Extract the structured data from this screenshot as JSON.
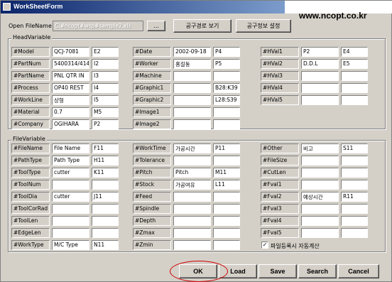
{
  "window": {
    "title": "WorkSheetForm",
    "url_banner": "www.ncopt.co.kr"
  },
  "file": {
    "label": "Open FileName",
    "value": "C:#ncopt#wsp#sample2.xls",
    "browse_label": "...",
    "view_path_label": "공구경로 보기",
    "tool_info_label": "공구정보 설정"
  },
  "head": {
    "title": "HeadVariable",
    "columns": [
      [
        {
          "name": "#Model",
          "value": "QCJ-7081",
          "code": "E2"
        },
        {
          "name": "#PartNum",
          "value": "5400314/414",
          "code": "I2"
        },
        {
          "name": "#PartName",
          "value": "PNL QTR IN",
          "code": "I3"
        },
        {
          "name": "#Process",
          "value": "OP40 REST",
          "code": "I4"
        },
        {
          "name": "#WorkLine",
          "value": "상형",
          "code": "I5"
        },
        {
          "name": "#Material",
          "value": "0.7",
          "code": "M5"
        },
        {
          "name": "#Company",
          "value": "OGIHARA",
          "code": "P2"
        }
      ],
      [
        {
          "name": "#Date",
          "value": "2002-09-18",
          "code": "P4"
        },
        {
          "name": "#Worker",
          "value": "홍길동",
          "code": "P5"
        },
        {
          "name": "#Machine",
          "value": "",
          "code": ""
        },
        {
          "name": "#Graphic1",
          "value": "",
          "code": "B28:K39"
        },
        {
          "name": "#Graphic2",
          "value": "",
          "code": "L28:S39"
        },
        {
          "name": "#Image1",
          "value": "",
          "code": ""
        },
        {
          "name": "#Image2",
          "value": "",
          "code": ""
        }
      ],
      [
        {
          "name": "#HVal1",
          "value": "P2",
          "code": "E4"
        },
        {
          "name": "#HVal2",
          "value": "D.D.L",
          "code": "E5"
        },
        {
          "name": "#HVal3",
          "value": "",
          "code": ""
        },
        {
          "name": "#HVal4",
          "value": "",
          "code": ""
        },
        {
          "name": "#HVal5",
          "value": "",
          "code": ""
        }
      ]
    ]
  },
  "filevar": {
    "title": "FileVariable",
    "columns": [
      [
        {
          "name": "#FileName",
          "value": "File Name",
          "code": "F11"
        },
        {
          "name": "#PathType",
          "value": "Path Type",
          "code": "H11"
        },
        {
          "name": "#ToolType",
          "value": "cutter",
          "code": "K11"
        },
        {
          "name": "#ToolNum",
          "value": "",
          "code": ""
        },
        {
          "name": "#ToolDia",
          "value": "cutter",
          "code": "J11"
        },
        {
          "name": "#ToolCorRad",
          "value": "",
          "code": ""
        },
        {
          "name": "#ToolLen",
          "value": "",
          "code": ""
        },
        {
          "name": "#EdgeLen",
          "value": "",
          "code": ""
        },
        {
          "name": "#WorkType",
          "value": "M/C Type",
          "code": "N11"
        }
      ],
      [
        {
          "name": "#WorkTime",
          "value": "가공시간",
          "code": "P11"
        },
        {
          "name": "#Tolerance",
          "value": "",
          "code": ""
        },
        {
          "name": "#Pitch",
          "value": "Pitch",
          "code": "M11"
        },
        {
          "name": "#Stock",
          "value": "가공여유",
          "code": "L11"
        },
        {
          "name": "#Feed",
          "value": "",
          "code": ""
        },
        {
          "name": "#Spindle",
          "value": "",
          "code": ""
        },
        {
          "name": "#Depth",
          "value": "",
          "code": ""
        },
        {
          "name": "#Zmax",
          "value": "",
          "code": ""
        },
        {
          "name": "#Zmin",
          "value": "",
          "code": ""
        }
      ],
      [
        {
          "name": "#Other",
          "value": "비고",
          "code": "S11"
        },
        {
          "name": "#FileSize",
          "value": "",
          "code": ""
        },
        {
          "name": "#CutLen",
          "value": "",
          "code": ""
        },
        {
          "name": "#Fval1",
          "value": "",
          "code": ""
        },
        {
          "name": "#Fval2",
          "value": "예상시간",
          "code": "R11"
        },
        {
          "name": "#Fval3",
          "value": "",
          "code": ""
        },
        {
          "name": "#Fval4",
          "value": "",
          "code": ""
        },
        {
          "name": "#Fval5",
          "value": "",
          "code": ""
        }
      ]
    ],
    "auto_calc": {
      "label": "파일등록시 자동계산",
      "checked": true,
      "mark": "✓"
    }
  },
  "actions": {
    "ok": "OK",
    "load": "Load",
    "save": "Save",
    "search": "Search",
    "cancel": "Cancel"
  },
  "colors": {
    "window_bg": "#d4d0c8",
    "title_start": "#0a246a",
    "title_end": "#a6caf0",
    "highlight": "#d00000"
  }
}
